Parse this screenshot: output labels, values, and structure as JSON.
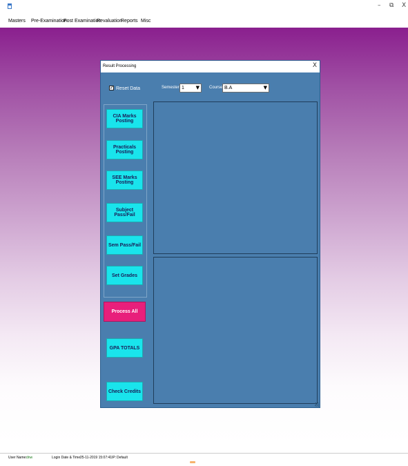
{
  "window": {
    "icon": "app-icon",
    "controls": {
      "minimize": "–",
      "maximize": "⧉",
      "close": "X"
    }
  },
  "menu": [
    "Masters",
    "Pre-Examination",
    "Post Examination",
    "Revaluation",
    "Reports",
    "Misc"
  ],
  "dialog": {
    "title": "Result Processing",
    "close": "X",
    "reset_checked": true,
    "reset_label": "Reset Data",
    "semester_label": "Semester",
    "semester_value": "1",
    "course_label": "Course",
    "course_value": "B.A",
    "dropdown_arrow": "▼",
    "check_mark": "✓",
    "buttons": [
      "CIA Marks Posting",
      "Practicals Posting",
      "SEE Marks Posting",
      "Subject Pass/Fail",
      "Sem Pass/Fail",
      "Set Grades",
      "Process All",
      "GPA TOTALS",
      "Check Credits"
    ]
  },
  "status": {
    "user_label": "User Name:",
    "user_value": "dnw",
    "login_label": "Login Date & Time:",
    "login_value": "25-11-2019 15:07:41",
    "ip_label": "IP:",
    "ip_value": "Default"
  },
  "colors": {
    "dialog_bg": "#4a7eae",
    "button_cyan": "#19e4ec",
    "button_primary": "#e81f7b",
    "desktop_top": "#8a1f8e"
  }
}
